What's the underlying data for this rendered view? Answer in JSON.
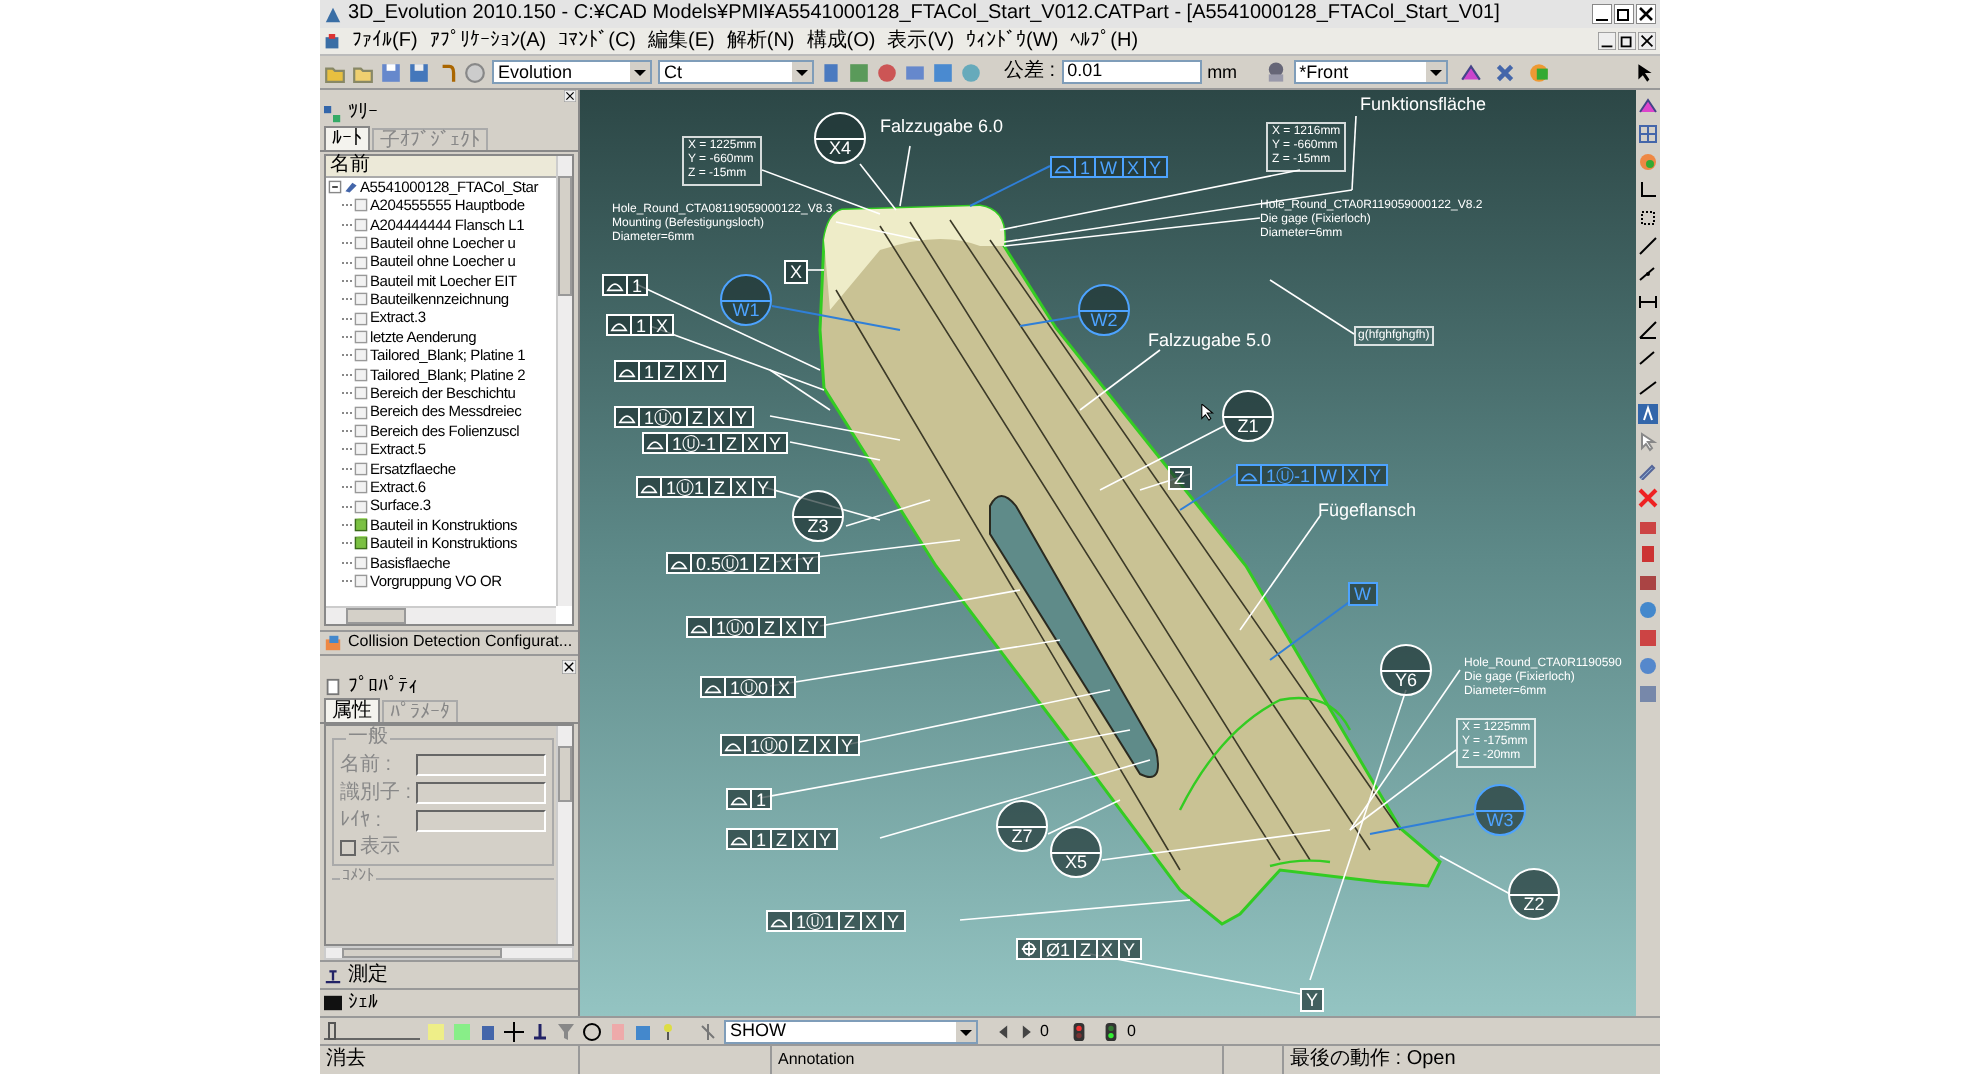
{
  "window": {
    "title": "3D_Evolution 2010.150 - C:¥CAD Models¥PMI¥A5541000128_FTACol_Start_V012.CATPart - [A5541000128_FTACol_Start_V01]"
  },
  "menu": [
    "ﾌｧｲﾙ(F)",
    "ｱﾌﾟﾘｹｰｼｮﾝ(A)",
    "ｺﾏﾝﾄﾞ(C)",
    "編集(E)",
    "解析(N)",
    "構成(O)",
    "表示(V)",
    "ｳｨﾝﾄﾞｳ(W)",
    "ﾍﾙﾌﾟ(H)"
  ],
  "toolbar": {
    "profile": "Evolution",
    "filter": "Ct",
    "tolerance_label": "公差 :",
    "tolerance": "0.01",
    "unit": "mm",
    "view": "*Front"
  },
  "tree": {
    "title": "ﾂﾘｰ",
    "tabs": [
      {
        "label": "ﾙｰﾄ",
        "selected": true
      },
      {
        "label": "子ｵﾌﾞｼﾞｪｸﾄ",
        "selected": false
      }
    ],
    "column": "名前",
    "root": {
      "label": "A5541000128_FTACol_Star",
      "expanded": true,
      "children": [
        {
          "label": "A204555555 Hauptbode",
          "kind": "geometry"
        },
        {
          "label": "A204444444 Flansch L1",
          "kind": "geometry"
        },
        {
          "label": "Bauteil ohne Loecher u",
          "kind": "geometry"
        },
        {
          "label": "Bauteil ohne Loecher u",
          "kind": "geometry"
        },
        {
          "label": "Bauteil mit Loecher EIT",
          "kind": "geometry"
        },
        {
          "label": "Bauteilkennzeichnung",
          "kind": "geometry"
        },
        {
          "label": "Extract.3",
          "kind": "geometry"
        },
        {
          "label": "letzte Aenderung",
          "kind": "geometry"
        },
        {
          "label": "Tailored_Blank; Platine 1",
          "kind": "geometry"
        },
        {
          "label": "Tailored_Blank; Platine 2",
          "kind": "geometry"
        },
        {
          "label": "Bereich der Beschichtu",
          "kind": "geometry"
        },
        {
          "label": "Bereich des Messdreiec",
          "kind": "geometry"
        },
        {
          "label": "Bereich des Folienzuscl",
          "kind": "geometry"
        },
        {
          "label": "Extract.5",
          "kind": "geometry"
        },
        {
          "label": "Ersatzflaeche",
          "kind": "geometry"
        },
        {
          "label": "Extract.6",
          "kind": "geometry"
        },
        {
          "label": "Surface.3",
          "kind": "geometry"
        },
        {
          "label": "Bauteil in Konstruktions",
          "kind": "body"
        },
        {
          "label": "Bauteil in Konstruktions",
          "kind": "body"
        },
        {
          "label": "Basisflaeche",
          "kind": "geometry"
        },
        {
          "label": "Vorgruppung VO OR",
          "kind": "geometry"
        }
      ]
    }
  },
  "collision_panel": {
    "title": "Collision Detection Configurat..."
  },
  "properties": {
    "title": "ﾌﾟﾛﾊﾟﾃｨ",
    "tabs": [
      {
        "label": "属性",
        "selected": true
      },
      {
        "label": "ﾊﾟﾗﾒｰﾀ",
        "selected": false
      }
    ],
    "group": "一般",
    "fields": [
      {
        "label": "名前 :"
      },
      {
        "label": "識別子 :"
      },
      {
        "label": "ﾚｲﾔ :"
      }
    ],
    "show": {
      "label": "表示",
      "checked": false
    },
    "comment_group": "ｺﾒﾝﾄ"
  },
  "panels": [
    {
      "label": "測定"
    },
    {
      "label": "ｼｪﾙ"
    }
  ],
  "annotations": [
    {
      "kind": "text",
      "text": "Funktionsfläche"
    },
    {
      "kind": "coords",
      "lines": [
        "X = 1225mm",
        "Y = -660mm",
        "Z = -15mm"
      ]
    },
    {
      "kind": "datum",
      "label": "X4",
      "color": "#ffffff"
    },
    {
      "kind": "text",
      "text": "Falzzugabe 6.0"
    },
    {
      "kind": "profile_frame",
      "cells": [
        "1",
        "W",
        "X",
        "Y"
      ],
      "color": "#4da3ff"
    },
    {
      "kind": "coords",
      "lines": [
        "X = 1216mm",
        "Y = -660mm",
        "Z = -15mm"
      ]
    },
    {
      "kind": "note",
      "lines": [
        "Hole_Round_CTA08119059000122_V8.3",
        "Mounting (Befestigungsloch)",
        "Diameter=6mm"
      ]
    },
    {
      "kind": "note",
      "lines": [
        "Hole_Round_CTA0R119059000122_V8.2",
        "Die gage (Fixierloch)",
        "Diameter=6mm"
      ]
    },
    {
      "kind": "datum_box",
      "label": "X",
      "color": "#ffffff"
    },
    {
      "kind": "profile_frame",
      "cells": [
        "1"
      ],
      "color": "#ffffff"
    },
    {
      "kind": "datum",
      "label": "W1",
      "color": "#4da3ff"
    },
    {
      "kind": "datum",
      "label": "W2",
      "color": "#4da3ff"
    },
    {
      "kind": "profile_frame",
      "cells": [
        "1",
        "X"
      ],
      "color": "#ffffff"
    },
    {
      "kind": "tag",
      "text": "g(hfghfghgfh)"
    },
    {
      "kind": "text",
      "text": "Falzzugabe 5.0"
    },
    {
      "kind": "profile_frame",
      "cells": [
        "1",
        "Z",
        "X",
        "Y"
      ],
      "color": "#ffffff"
    },
    {
      "kind": "profile_frame",
      "cells": [
        "1Ⓤ0",
        "Z",
        "X",
        "Y"
      ],
      "color": "#ffffff"
    },
    {
      "kind": "datum",
      "label": "Z1",
      "color": "#ffffff"
    },
    {
      "kind": "profile_frame",
      "cells": [
        "1Ⓤ-1",
        "Z",
        "X",
        "Y"
      ],
      "color": "#ffffff"
    },
    {
      "kind": "datum_box",
      "label": "Z",
      "color": "#ffffff"
    },
    {
      "kind": "profile_frame",
      "cells": [
        "1Ⓤ-1",
        "W",
        "X",
        "Y"
      ],
      "color": "#4da3ff"
    },
    {
      "kind": "profile_frame",
      "cells": [
        "1Ⓤ1",
        "Z",
        "X",
        "Y"
      ],
      "color": "#ffffff"
    },
    {
      "kind": "text",
      "text": "Fügeflansch"
    },
    {
      "kind": "datum",
      "label": "Z3",
      "color": "#ffffff"
    },
    {
      "kind": "profile_frame",
      "cells": [
        "0.5Ⓤ1",
        "Z",
        "X",
        "Y"
      ],
      "color": "#ffffff"
    },
    {
      "kind": "datum_box",
      "label": "W",
      "color": "#4da3ff"
    },
    {
      "kind": "profile_frame",
      "cells": [
        "1Ⓤ0",
        "Z",
        "X",
        "Y"
      ],
      "color": "#ffffff"
    },
    {
      "kind": "profile_frame",
      "cells": [
        "1Ⓤ0",
        "X"
      ],
      "color": "#ffffff"
    },
    {
      "kind": "datum",
      "label": "Y6",
      "color": "#ffffff"
    },
    {
      "kind": "note",
      "lines": [
        "Hole_Round_CTA0R1190590",
        "Die gage (Fixierloch)",
        "Diameter=6mm"
      ]
    },
    {
      "kind": "profile_frame",
      "cells": [
        "1Ⓤ0",
        "Z",
        "X",
        "Y"
      ],
      "color": "#ffffff"
    },
    {
      "kind": "coords",
      "lines": [
        "X = 1225mm",
        "Y = -175mm",
        "Z = -20mm"
      ]
    },
    {
      "kind": "profile_frame",
      "cells": [
        "1"
      ],
      "color": "#ffffff"
    },
    {
      "kind": "datum",
      "label": "W3",
      "color": "#4da3ff"
    },
    {
      "kind": "datum",
      "label": "Z7",
      "color": "#ffffff"
    },
    {
      "kind": "profile_frame",
      "cells": [
        "1",
        "Z",
        "X",
        "Y"
      ],
      "color": "#ffffff"
    },
    {
      "kind": "datum",
      "label": "X5",
      "color": "#ffffff"
    },
    {
      "kind": "datum",
      "label": "Z2",
      "color": "#ffffff"
    },
    {
      "kind": "profile_frame",
      "cells": [
        "1Ⓤ1",
        "Z",
        "X",
        "Y"
      ],
      "color": "#ffffff"
    },
    {
      "kind": "position_frame",
      "cells": [
        "Ø1",
        "Z",
        "X",
        "Y"
      ],
      "color": "#ffffff"
    },
    {
      "kind": "datum_box",
      "label": "Y",
      "color": "#ffffff"
    }
  ],
  "bottom_toolbar": {
    "slider": {
      "level": 0.05
    },
    "mode": "SHOW",
    "count_1": "0",
    "count_2": "0"
  },
  "status_bar": {
    "left": "消去",
    "mode": "Annotation",
    "last_action": "最後の動作 : Open"
  }
}
